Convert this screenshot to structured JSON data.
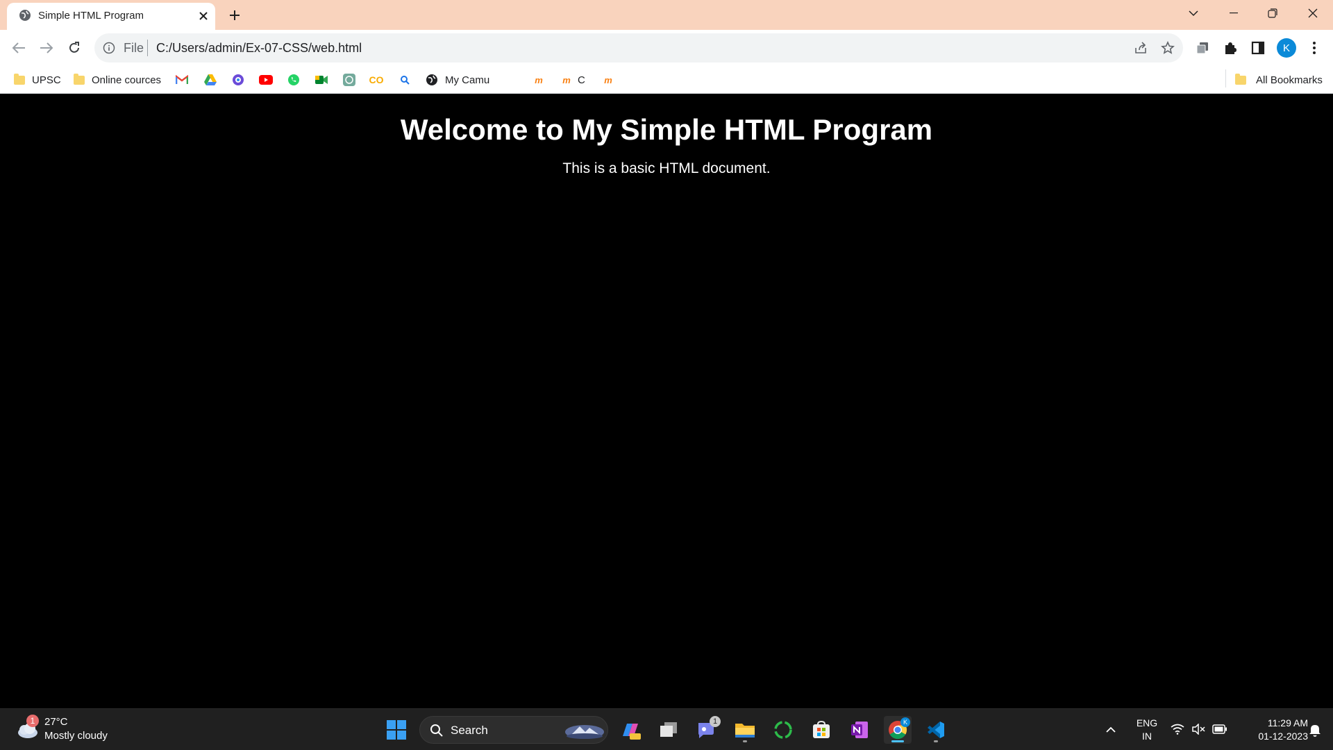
{
  "browser": {
    "tab_title": "Simple HTML Program",
    "url_scheme": "File",
    "url": "C:/Users/admin/Ex-07-CSS/web.html",
    "profile_initial": "K",
    "bookmarks": [
      {
        "label": "UPSC",
        "icon": "folder-icon"
      },
      {
        "label": "Online cources",
        "icon": "folder-icon"
      },
      {
        "label": "",
        "icon": "gmail-icon"
      },
      {
        "label": "",
        "icon": "google-drive-icon"
      },
      {
        "label": "",
        "icon": "copilot-icon"
      },
      {
        "label": "",
        "icon": "youtube-icon"
      },
      {
        "label": "",
        "icon": "whatsapp-icon"
      },
      {
        "label": "",
        "icon": "google-meet-icon"
      },
      {
        "label": "",
        "icon": "chatgpt-icon"
      },
      {
        "label": "",
        "icon": "colab-icon"
      },
      {
        "label": "",
        "icon": "search-bookmark-icon"
      },
      {
        "label": "My Camu",
        "icon": "globe-icon"
      },
      {
        "label": "",
        "icon": "moodle-icon"
      },
      {
        "label": "C",
        "icon": "moodle-icon"
      },
      {
        "label": "",
        "icon": "moodle-icon"
      }
    ],
    "all_bookmarks": "All Bookmarks"
  },
  "page": {
    "heading": "Welcome to My Simple HTML Program",
    "paragraph": "This is a basic HTML document."
  },
  "taskbar": {
    "weather_temp": "27°C",
    "weather_desc": "Mostly cloudy",
    "weather_badge": "1",
    "search_label": "Search",
    "teams_badge": "1",
    "lang_1": "ENG",
    "lang_2": "IN",
    "time": "11:29 AM",
    "date": "01-12-2023"
  },
  "colors": {
    "tab_strip": "#f9d3bd",
    "page_background": "#000000",
    "taskbar": "#202020",
    "profile": "#0b8ad8"
  }
}
